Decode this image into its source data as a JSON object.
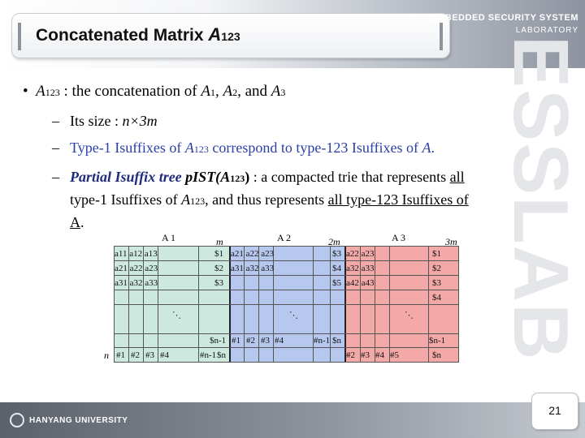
{
  "header": {
    "title_main": "Concatenated Matrix ",
    "title_letter": "A",
    "title_sub": "123",
    "lab_line1": "EMBEDDED SECURITY SYSTEM",
    "lab_line2": "LABORATORY"
  },
  "watermark": "ESSLAB",
  "bullet": {
    "marker": "•",
    "a": "A",
    "a_sub": "123",
    "text1": " : the concatenation of ",
    "a1": "A",
    "s1": "1",
    "comma1": ", ",
    "a2": "A",
    "s2": "2",
    "and": ", and ",
    "a3": "A",
    "s3": "3"
  },
  "sub1": {
    "dash": "–",
    "text": "Its size : ",
    "size": "n×3m"
  },
  "sub2": {
    "dash": "–",
    "text1": "Type-1 Isuffixes of ",
    "a": "A",
    "a_sub": "123",
    "text2": " correspond to type-123 Isuffixes of ",
    "a_end": "A",
    "end": "."
  },
  "sub3": {
    "dash": "–",
    "lead": "Partial Isuffix tree ",
    "pist": "pIST(",
    "pa": "A",
    "pa_sub": "123",
    "close": ")",
    "text1": " : a compacted trie that represents ",
    "all1": "all",
    "line2a": "type-1 Isuffixes of ",
    "a": "A",
    "a_sub": "123",
    "line2b": ", and thus represents ",
    "all2": "all type-123 Isuffixes of",
    "line3": "A",
    "end": "."
  },
  "figure": {
    "labels": {
      "A1": "A 1",
      "A2": "A 2",
      "A3": "A 3",
      "m": "m",
      "two_m": "2m",
      "three_m": "3m",
      "n": "n"
    },
    "colors": {
      "a1": "#cde9df",
      "a2": "#b7c8ef",
      "a3": "#f4a9a9"
    },
    "a1_rows": [
      "a11 a12 a13",
      "a21 a22 a23",
      "a31 a32 a33"
    ],
    "a2_rows": [
      "a21 a22 a23",
      "a31 a32 a33"
    ],
    "a3_rows": [
      "a22 a23",
      "a32 a33",
      "a42 a43"
    ],
    "dollar_a1": [
      "$1",
      "$2",
      "$3"
    ],
    "dollar_a2": [
      "$3",
      "$4",
      "$5"
    ],
    "dollar_a3": [
      "$1",
      "$2",
      "$3",
      "$4"
    ],
    "bottom_a1": [
      "#1",
      "#2",
      "#3",
      "#4"
    ],
    "bottom_a1_end": "#n-1",
    "bottom_a1_last": "$n",
    "bottom_a2": [
      "#1",
      "#2",
      "#3",
      "#4"
    ],
    "bottom_a2_end": "#n-1",
    "bottom_a2_last": "$n",
    "bottom_a3": [
      "#2",
      "#3",
      "#4",
      "#5"
    ],
    "bottom_a3_last": "$n",
    "sn1_a1": "$n-1",
    "sn1_a3": "$n-1"
  },
  "footer": {
    "university": "HANYANG UNIVERSITY",
    "page": "21"
  }
}
